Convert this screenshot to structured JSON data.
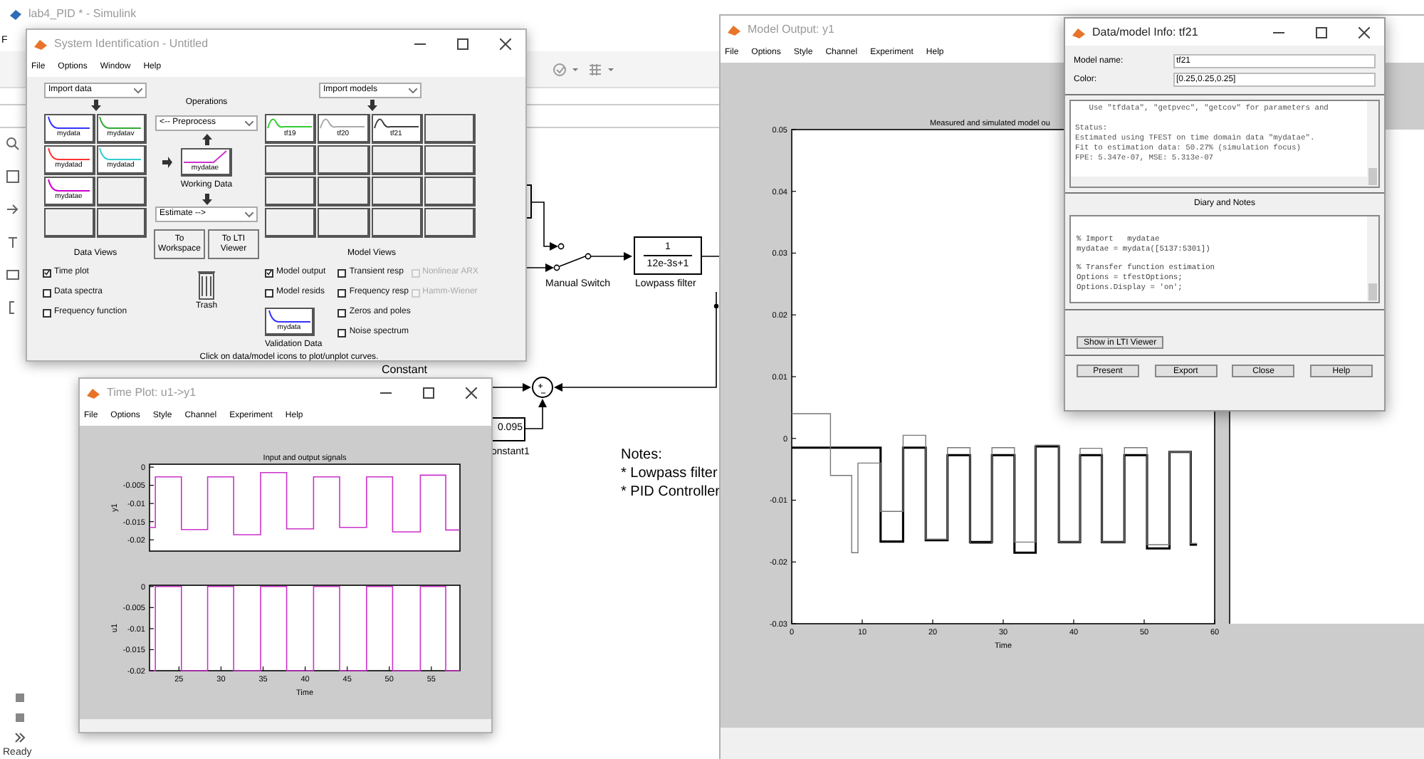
{
  "simulink": {
    "title": "lab4_PID * - Simulink",
    "menu_fragment": "F",
    "status": "Ready",
    "diagram": {
      "switch_label": "Manual Switch",
      "filter": {
        "numerator": "1",
        "denominator": "12e-3s+1",
        "label": "Lowpass filter"
      },
      "constant_label": "Constant",
      "constant1": {
        "value": "0.095",
        "label": "onstant1"
      }
    },
    "notes": [
      "Notes:",
      "* Lowpass filter",
      "* PID Controller"
    ]
  },
  "system_identification": {
    "title": "System Identification - Untitled",
    "menu": [
      "File",
      "Options",
      "Window",
      "Help"
    ],
    "import_data": "Import data",
    "import_models": "Import models",
    "operations": "Operations",
    "preprocess": "<-- Preprocess",
    "working_data": {
      "name": "mydatae",
      "caption": "Working Data",
      "color": "#cc33cc"
    },
    "estimate": "Estimate -->",
    "data_slots": [
      {
        "kind": "data",
        "name": "mydata",
        "color": "#3333ff"
      },
      {
        "kind": "data",
        "name": "mydatav",
        "color": "#33aa33"
      },
      {
        "kind": "data",
        "name": "mydatad",
        "color": "#ff3333"
      },
      {
        "kind": "data",
        "name": "mydatad",
        "color": "#33cccc"
      },
      {
        "kind": "data",
        "name": "mydatae",
        "color": "#cc00cc"
      },
      {
        "kind": "empty"
      },
      {
        "kind": "empty"
      },
      {
        "kind": "empty"
      }
    ],
    "model_slots": [
      {
        "kind": "model",
        "name": "tf19",
        "color": "#33cc33"
      },
      {
        "kind": "model",
        "name": "tf20",
        "color": "#aaaaaa"
      },
      {
        "kind": "model",
        "name": "tf21",
        "color": "#404040"
      },
      {
        "kind": "empty"
      },
      {
        "kind": "empty"
      },
      {
        "kind": "empty"
      },
      {
        "kind": "empty"
      },
      {
        "kind": "empty"
      },
      {
        "kind": "empty"
      },
      {
        "kind": "empty"
      },
      {
        "kind": "empty"
      },
      {
        "kind": "empty"
      },
      {
        "kind": "empty"
      },
      {
        "kind": "empty"
      },
      {
        "kind": "empty"
      },
      {
        "kind": "empty"
      }
    ],
    "buttons": [
      "To Workspace",
      "To LTI Viewer"
    ],
    "trash": "Trash",
    "data_views": {
      "title": "Data Views",
      "options": [
        {
          "label": "Time plot",
          "checked": true
        },
        {
          "label": "Data spectra",
          "checked": false
        },
        {
          "label": "Frequency function",
          "checked": false
        }
      ]
    },
    "model_views": {
      "title": "Model Views",
      "columns": [
        {
          "options": [
            {
              "label": "Model output",
              "checked": true,
              "disabled": false
            },
            {
              "label": "Model resids",
              "checked": false,
              "disabled": false
            }
          ]
        },
        {
          "options": [
            {
              "label": "Transient resp",
              "checked": false,
              "disabled": false
            },
            {
              "label": "Frequency resp",
              "checked": false,
              "disabled": false
            },
            {
              "label": "Zeros and poles",
              "checked": false,
              "disabled": false
            },
            {
              "label": "Noise spectrum",
              "checked": false,
              "disabled": false
            }
          ]
        },
        {
          "options": [
            {
              "label": "Nonlinear ARX",
              "checked": false,
              "disabled": true
            },
            {
              "label": "Hamm-Wiener",
              "checked": false,
              "disabled": true
            }
          ]
        }
      ]
    },
    "validation_data": {
      "name": "mydata",
      "caption": "Validation Data",
      "color": "#3333ff"
    },
    "hint": "Click on data/model icons to plot/unplot curves."
  },
  "time_plot": {
    "title": "Time Plot: u1->y1",
    "menu": [
      "File",
      "Options",
      "Style",
      "Channel",
      "Experiment",
      "Help"
    ],
    "charts": [
      {
        "chart_data": {
          "type": "line",
          "title": "Input and output signals",
          "ylabel": "y1",
          "xlim": [
            21.5,
            58.4
          ],
          "ylim": [
            -0.0231,
            0.0008
          ],
          "yticks": [
            0,
            -0.005,
            -0.01,
            -0.015,
            -0.02
          ],
          "x": [
            21.5,
            22.2,
            22.2,
            25.3,
            25.3,
            28.4,
            28.4,
            31.5,
            31.5,
            34.7,
            34.7,
            37.8,
            37.8,
            41,
            41,
            44.1,
            44.1,
            47.3,
            47.3,
            50.4,
            50.4,
            53.7,
            53.7,
            56.7,
            56.7,
            58.4
          ],
          "series": [
            {
              "color": "#cc33cc",
              "values": [
                -0.0166,
                -0.0166,
                -0.0027,
                -0.0027,
                -0.0172,
                -0.0172,
                -0.0027,
                -0.0027,
                -0.0186,
                -0.0186,
                -0.0015,
                -0.0015,
                -0.017,
                -0.017,
                -0.0027,
                -0.0027,
                -0.0166,
                -0.0166,
                -0.0027,
                -0.0027,
                -0.0178,
                -0.0178,
                -0.0022,
                -0.0022,
                -0.0173,
                -0.0173
              ]
            }
          ]
        }
      },
      {
        "chart_data": {
          "type": "line",
          "xlabel": "Time",
          "ylabel": "u1",
          "xlim": [
            21.5,
            58.4
          ],
          "ylim": [
            -0.02,
            0.0003
          ],
          "xticks": [
            25,
            30,
            35,
            40,
            45,
            50,
            55
          ],
          "yticks": [
            0,
            -0.005,
            -0.01,
            -0.015,
            -0.02
          ],
          "x": [
            21.5,
            22.2,
            22.2,
            25.3,
            25.3,
            28.4,
            28.4,
            31.5,
            31.5,
            34.7,
            34.7,
            37.8,
            37.8,
            41,
            41,
            44.1,
            44.1,
            47.3,
            47.3,
            50.4,
            50.4,
            53.7,
            53.7,
            56.7,
            56.7,
            58.4
          ],
          "series": [
            {
              "color": "#cc33cc",
              "values": [
                -0.02,
                -0.02,
                0,
                0,
                -0.02,
                -0.02,
                0,
                0,
                -0.02,
                -0.02,
                0,
                0,
                -0.02,
                -0.02,
                0,
                0,
                -0.02,
                -0.02,
                0,
                0,
                -0.02,
                -0.02,
                0,
                0,
                -0.02,
                -0.02
              ]
            }
          ]
        }
      }
    ]
  },
  "model_output": {
    "title": "Model Output: y1",
    "menu": [
      "File",
      "Options",
      "Style",
      "Channel",
      "Experiment",
      "Help"
    ],
    "chart_data": {
      "type": "line",
      "title": "Measured and simulated model ou",
      "xlabel": "Time",
      "xlim": [
        0,
        60
      ],
      "ylim": [
        -0.03,
        0.05
      ],
      "xticks": [
        0,
        10,
        20,
        30,
        40,
        50,
        60
      ],
      "yticks": [
        0.05,
        0.04,
        0.03,
        0.02,
        0.01,
        0,
        -0.01,
        -0.02,
        -0.03
      ],
      "x": [
        0,
        5.5,
        5.5,
        8.5,
        8.5,
        9.4,
        9.4,
        12.6,
        12.6,
        15.8,
        15.8,
        19,
        19,
        22.1,
        22.1,
        25.3,
        25.3,
        28.4,
        28.4,
        31.6,
        31.6,
        34.6,
        34.6,
        37.9,
        37.9,
        40.9,
        40.9,
        44,
        44,
        47.2,
        47.2,
        50.4,
        50.4,
        53.6,
        53.6,
        56.6,
        56.6,
        57.5
      ],
      "series": [
        {
          "color": "#000000",
          "values": [
            -0.0015,
            -0.0015,
            -0.0015,
            -0.0015,
            -0.0015,
            -0.0015,
            -0.0015,
            -0.0015,
            -0.0167,
            -0.0167,
            -0.0015,
            -0.0015,
            -0.0165,
            -0.0165,
            -0.0027,
            -0.0027,
            -0.0168,
            -0.0168,
            -0.0027,
            -0.0027,
            -0.0185,
            -0.0185,
            -0.0013,
            -0.0013,
            -0.0168,
            -0.0168,
            -0.0027,
            -0.0027,
            -0.0168,
            -0.0168,
            -0.0027,
            -0.0027,
            -0.0178,
            -0.0178,
            -0.0022,
            -0.0022,
            -0.0172,
            -0.0172
          ]
        },
        {
          "color": "#777777",
          "values": [
            0.004,
            0.004,
            -0.006,
            -0.006,
            -0.0185,
            -0.0185,
            -0.004,
            -0.004,
            -0.0118,
            -0.0118,
            0.0005,
            0.0005,
            -0.0163,
            -0.0163,
            -0.0015,
            -0.0015,
            -0.017,
            -0.017,
            -0.0015,
            -0.0015,
            -0.0168,
            -0.0168,
            -0.0011,
            -0.0011,
            -0.0168,
            -0.0168,
            -0.0016,
            -0.0016,
            -0.0168,
            -0.0168,
            -0.0015,
            -0.0015,
            -0.0172,
            -0.0172,
            -0.0022,
            -0.0022,
            -0.017,
            -0.017
          ]
        }
      ]
    }
  },
  "model_info": {
    "title": "Data/model Info: tf21",
    "fields": [
      {
        "label": "Model name:",
        "value": "tf21"
      },
      {
        "label": "Color:",
        "value": "[0.25,0.25,0.25]"
      }
    ],
    "info_header": "   Use \"tfdata\", \"getpvec\", \"getcov\" for parameters and",
    "status_lines": [
      "Status:",
      "Estimated using TFEST on time domain data \"mydatae\".",
      "Fit to estimation data: 50.27% (simulation focus)",
      "FPE: 5.347e-07, MSE: 5.313e-07"
    ],
    "diary_title": "Diary and Notes",
    "diary_blocks": [
      [
        "% Import   mydatae",
        "mydatae = mydata([5137:5301])"
      ],
      [
        "% Transfer function estimation",
        "Options = tfestOptions;",
        "Options.Display = 'on';"
      ]
    ],
    "show_button": "Show in LTI Viewer",
    "buttons": [
      "Present",
      "Export",
      "Close",
      "Help"
    ]
  }
}
